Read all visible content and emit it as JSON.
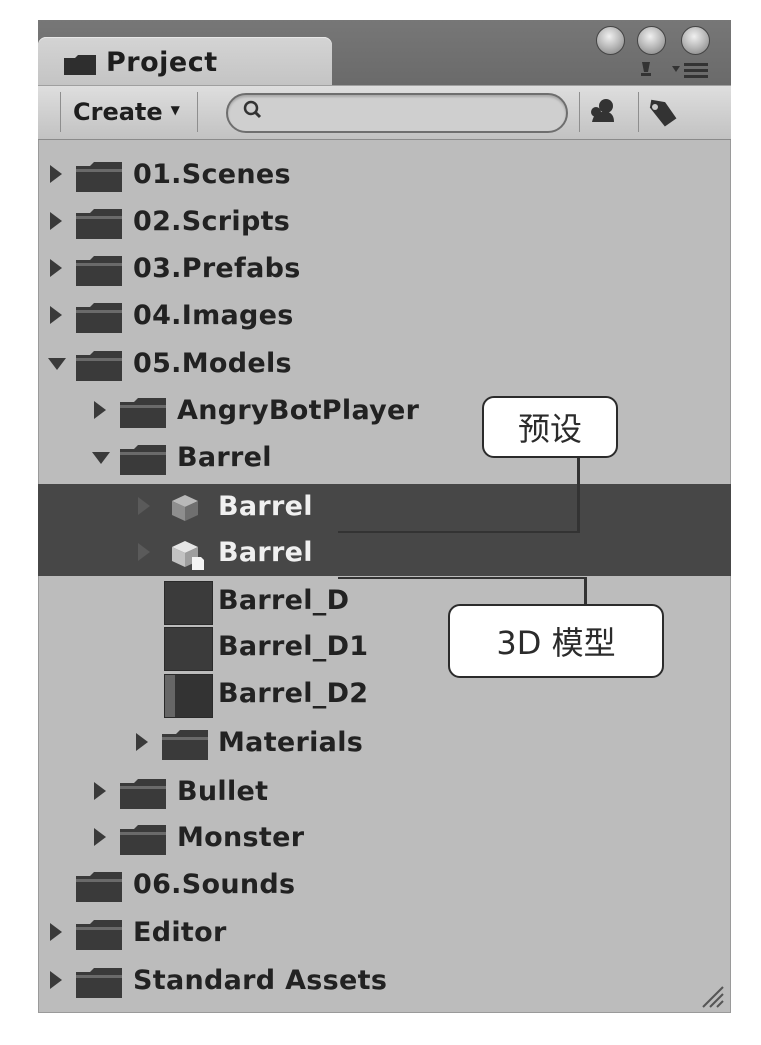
{
  "window": {
    "tab_title": "Project",
    "tab_icon": "folder-icon",
    "window_buttons": [
      "close-icon",
      "minimize-icon",
      "zoom-icon"
    ]
  },
  "toolbar": {
    "create_label": "Create",
    "search_placeholder": "",
    "search_value": ""
  },
  "tree": {
    "items": [
      {
        "label": "01.Scenes"
      },
      {
        "label": "02.Scripts"
      },
      {
        "label": "03.Prefabs"
      },
      {
        "label": "04.Images"
      },
      {
        "label": "05.Models"
      },
      {
        "label": "AngryBotPlayer"
      },
      {
        "label": "Barrel"
      },
      {
        "label": "Barrel"
      },
      {
        "label": "Barrel"
      },
      {
        "label": "Barrel_D"
      },
      {
        "label": "Barrel_D1"
      },
      {
        "label": "Barrel_D2"
      },
      {
        "label": "Materials"
      },
      {
        "label": "Bullet"
      },
      {
        "label": "Monster"
      },
      {
        "label": "06.Sounds"
      },
      {
        "label": "Editor"
      },
      {
        "label": "Standard Assets"
      }
    ]
  },
  "annotations": {
    "prefab_label": "预设",
    "model_label": "3D 模型"
  },
  "colors": {
    "panel_bg": "#bcbcbc",
    "selection": "#474747"
  }
}
